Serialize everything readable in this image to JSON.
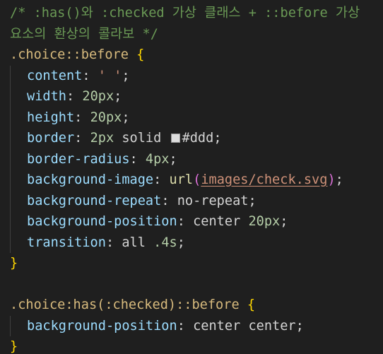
{
  "code": {
    "comment_line1": "/* :has()와 :checked 가상 클래스 + ::before 가상",
    "comment_line2": "요소의 환상의 콜라보 */",
    "rule1": {
      "selector": ".choice::before",
      "open_brace": " {",
      "close_brace": "}",
      "declarations": {
        "content": {
          "prop": "content",
          "colon": ": ",
          "value": "' '",
          "semi": ";"
        },
        "width": {
          "prop": "width",
          "colon": ": ",
          "value": "20px",
          "semi": ";"
        },
        "height": {
          "prop": "height",
          "colon": ": ",
          "value": "20px",
          "semi": ";"
        },
        "border": {
          "prop": "border",
          "colon": ": ",
          "value_num": "2px",
          "value_kw": " solid ",
          "value_color": "#ddd",
          "semi": ";"
        },
        "radius": {
          "prop": "border-radius",
          "colon": ": ",
          "value": "4px",
          "semi": ";"
        },
        "bgimage": {
          "prop": "background-image",
          "colon": ": ",
          "func": "url",
          "paren_open": "(",
          "url": "images/check.svg",
          "paren_close": ")",
          "semi": ";"
        },
        "bgrepeat": {
          "prop": "background-repeat",
          "colon": ": ",
          "value": "no-repeat",
          "semi": ";"
        },
        "bgpos": {
          "prop": "background-position",
          "colon": ": ",
          "value_kw": "center ",
          "value_num": "20px",
          "semi": ";"
        },
        "transition": {
          "prop": "transition",
          "colon": ": ",
          "value_kw": "all ",
          "value_num": ".4s",
          "semi": ";"
        }
      }
    },
    "rule2": {
      "selector": ".choice:has(:checked)::before",
      "open_brace": " {",
      "close_brace": "}",
      "bgpos": {
        "prop": "background-position",
        "colon": ": ",
        "value": "center center",
        "semi": ";"
      }
    },
    "swatch_color": "#dddddd"
  },
  "theme": {
    "background": "#1f1f1f",
    "comment": "#6a9955",
    "selector": "#d7ba7d",
    "brace": "#ffd700",
    "property": "#9cdcfe",
    "number": "#b5cea8",
    "string": "#ce9178",
    "function": "#dcdcaa"
  }
}
